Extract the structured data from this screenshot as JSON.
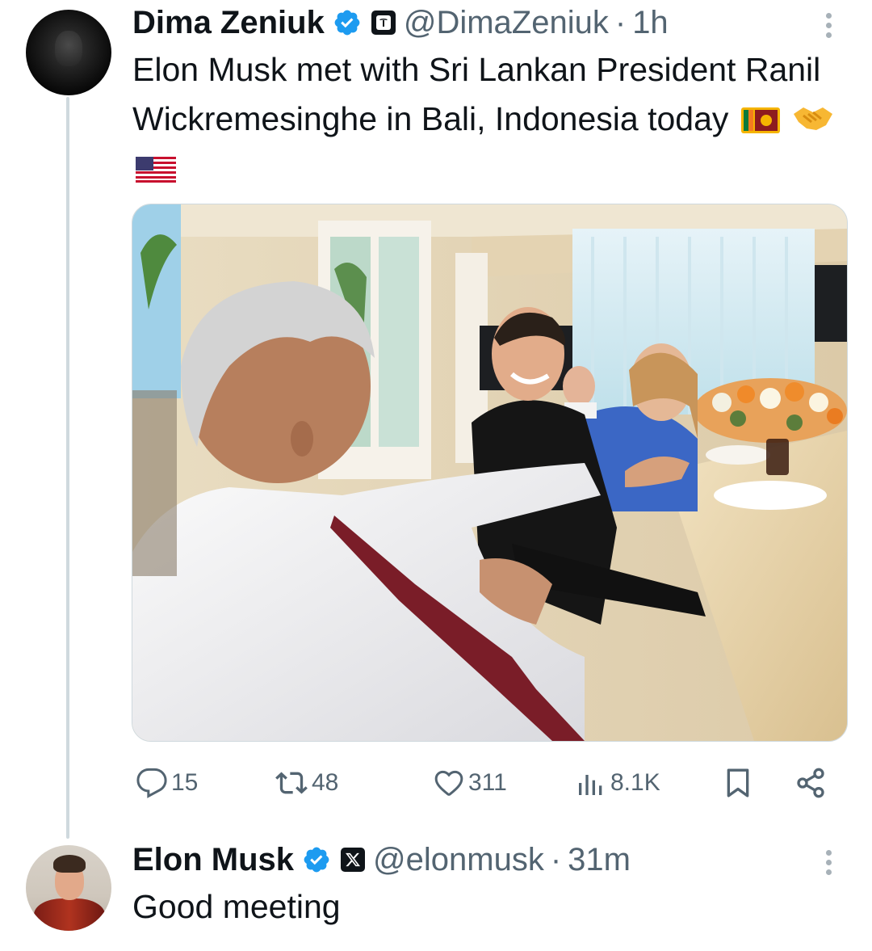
{
  "tweets": [
    {
      "display_name": "Dima Zeniuk",
      "verified_icon": "verified-badge-icon",
      "affiliation_icon": "tesla-logo-icon",
      "handle": "@DimaZeniuk",
      "separator": "·",
      "time": "1h",
      "text": "Elon Musk met with Sri Lankan President Ranil Wickremesinghe in Bali, Indonesia today",
      "emojis": [
        "flag-sri-lanka-icon",
        "handshake-icon",
        "flag-usa-icon"
      ],
      "media": "photo",
      "stats": {
        "replies": "15",
        "reposts": "48",
        "likes": "311",
        "views": "8.1K"
      }
    },
    {
      "display_name": "Elon Musk",
      "verified_icon": "verified-badge-icon",
      "affiliation_icon": "x-logo-icon",
      "handle": "@elonmusk",
      "separator": "·",
      "time": "31m",
      "text": "Good meeting"
    }
  ],
  "colors": {
    "verified_blue": "#1d9bf0",
    "muted_text": "#536471",
    "primary_text": "#0f1419",
    "thread_line": "#cfd9de"
  }
}
